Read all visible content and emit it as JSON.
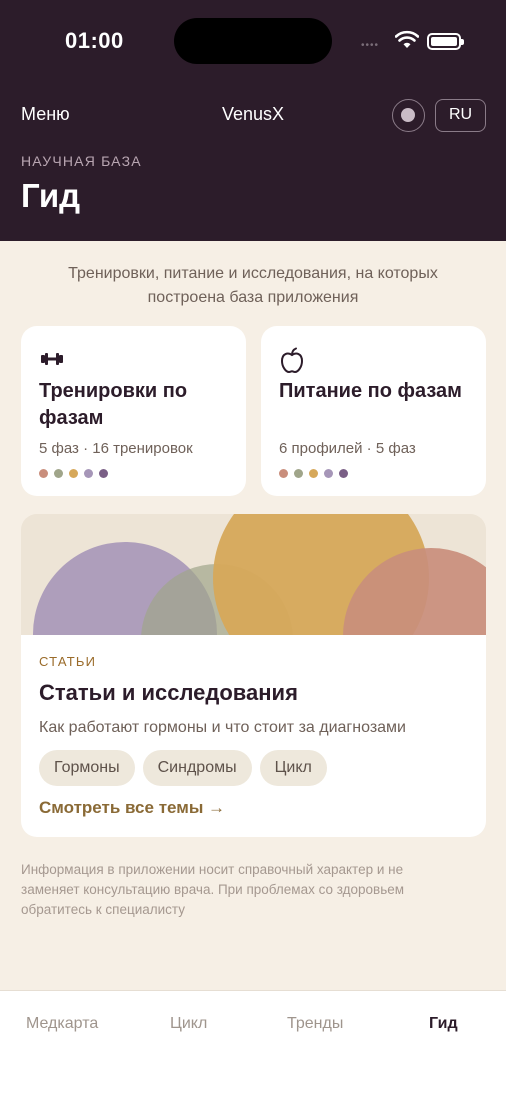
{
  "status_bar": {
    "time": "01:00"
  },
  "nav": {
    "menu_label": "Меню",
    "app_title": "VenusX",
    "lang_label": "RU"
  },
  "header": {
    "eyebrow": "НАУЧНАЯ БАЗА",
    "title": "Гид"
  },
  "subtitle": "Тренировки, питание и исследования, на которых построена база приложения",
  "cards": [
    {
      "title": "Тренировки по фазам",
      "meta": "5 фаз · 16 тренировок",
      "icon": "dumbbell-icon"
    },
    {
      "title": "Питание по фазам",
      "meta": "6 профилей · 5 фаз",
      "icon": "apple-icon"
    }
  ],
  "phase_colors": [
    "#c98e7c",
    "#a0a58a",
    "#d6a85a",
    "#a696b8",
    "#7a5f86"
  ],
  "articles": {
    "eyebrow": "СТАТЬИ",
    "title": "Статьи и исследования",
    "description": "Как работают гормоны и что стоит за диагнозами",
    "chips": [
      "Гормоны",
      "Синдромы",
      "Цикл"
    ],
    "see_all": "Смотреть все темы →"
  },
  "disclaimer": "Информация в приложении носит справочный характер и не заменяет консультацию врача. При проблемах со здоровьем обратитесь к специалисту",
  "tabs": [
    {
      "label": "Медкарта",
      "active": false
    },
    {
      "label": "Цикл",
      "active": false
    },
    {
      "label": "Тренды",
      "active": false
    },
    {
      "label": "Гид",
      "active": true
    }
  ]
}
